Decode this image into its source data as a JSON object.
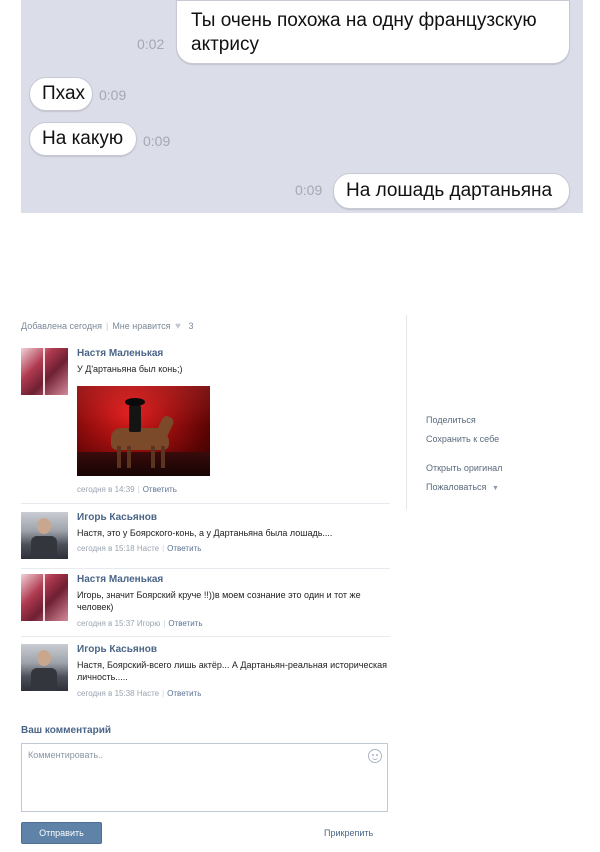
{
  "chat": {
    "messages": [
      {
        "text": "Ты очень похожа на одну французскую актрису",
        "time": "0:02",
        "side": "right"
      },
      {
        "text": "Пхах",
        "time": "0:09",
        "side": "left"
      },
      {
        "text": "На какую",
        "time": "0:09",
        "side": "left"
      },
      {
        "text": "На лошадь дартаньяна",
        "time": "0:09",
        "side": "right"
      }
    ]
  },
  "post": {
    "added": "Добавлена сегодня",
    "likes_label": "Мне нравится",
    "likes_count": "3"
  },
  "sidebar": {
    "share": "Поделиться",
    "save": "Сохранить к себе",
    "open_original": "Открыть оригинал",
    "report": "Пожаловаться"
  },
  "comments": [
    {
      "author": "Настя Маленькая",
      "text": "У Д'артаньяна был конь;)",
      "time": "сегодня в 14:39",
      "addressee": "",
      "reply": "Ответить"
    },
    {
      "author": "Игорь Касьянов",
      "text": "Настя, это у Боярского-конь, а у Дартаньяна была лошадь....",
      "time": "сегодня в 15:18",
      "addressee": "Насте",
      "reply": "Ответить"
    },
    {
      "author": "Настя Маленькая",
      "text": "Игорь, значит Боярский круче !!))в моем сознание это один и тот же человек)",
      "time": "сегодня в 15:37",
      "addressee": "Игорю",
      "reply": "Ответить"
    },
    {
      "author": "Игорь Касьянов",
      "text": "Настя, Боярский-всего лишь актёр... А Дартаньян-реальная историческая личность.....",
      "time": "сегодня в 15:38",
      "addressee": "Насте",
      "reply": "Ответить"
    }
  ],
  "comment_form": {
    "title": "Ваш комментарий",
    "placeholder": "Комментировать..",
    "send": "Отправить",
    "attach": "Прикрепить"
  }
}
